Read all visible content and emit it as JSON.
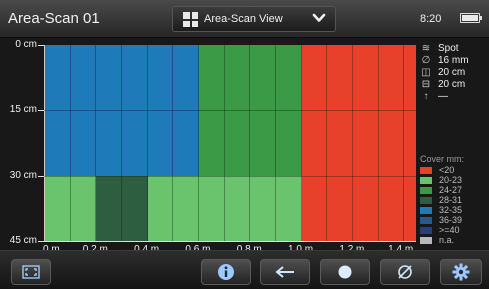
{
  "header": {
    "title": "Area-Scan 01",
    "view_selector": {
      "selected": "Area-Scan View",
      "icon": "grid-icon"
    },
    "time": "8:20",
    "battery_level": 1.0
  },
  "chart_data": {
    "type": "heatmap",
    "x_ticks": [
      "0 m",
      "0.2 m",
      "0.4 m",
      "0.6 m",
      "0.8 m",
      "1.0 m",
      "1.2 m",
      "1.4 m"
    ],
    "y_ticks": [
      "0 cm",
      "15 cm",
      "30 cm",
      "45 cm"
    ],
    "x_range": [
      0,
      1.4
    ],
    "y_range": [
      0,
      45
    ],
    "columns": [
      0,
      0.2,
      0.4,
      0.6,
      0.8,
      1.0,
      1.2,
      1.4
    ],
    "grid_lines": true,
    "cells": [
      {
        "x0": 0.0,
        "x1": 0.6,
        "y0": 0,
        "y1": 30,
        "cover_class": "32-35"
      },
      {
        "x0": 0.6,
        "x1": 1.0,
        "y0": 0,
        "y1": 30,
        "cover_class": "24-27"
      },
      {
        "x0": 1.0,
        "x1": 1.4,
        "y0": 0,
        "y1": 30,
        "cover_class": "<20"
      },
      {
        "x0": 1.4,
        "x1": 1.45,
        "y0": 0,
        "y1": 30,
        "cover_class": "<20"
      },
      {
        "x0": 0.0,
        "x1": 0.2,
        "y0": 30,
        "y1": 45,
        "cover_class": "20-23"
      },
      {
        "x0": 0.2,
        "x1": 0.4,
        "y0": 30,
        "y1": 45,
        "cover_class": "28-31"
      },
      {
        "x0": 0.4,
        "x1": 1.0,
        "y0": 30,
        "y1": 45,
        "cover_class": "20-23"
      },
      {
        "x0": 1.0,
        "x1": 1.45,
        "y0": 30,
        "y1": 45,
        "cover_class": "<20"
      }
    ]
  },
  "settings": [
    {
      "icon": "spot-icon",
      "value": "Spot"
    },
    {
      "icon": "diameter-icon",
      "value": "16 mm"
    },
    {
      "icon": "grid-x-icon",
      "value": "20 cm"
    },
    {
      "icon": "grid-y-icon",
      "value": "20 cm"
    },
    {
      "icon": "arrow-up-icon",
      "value": "—"
    }
  ],
  "legend": {
    "title": "Cover mm:",
    "items": [
      {
        "label": "<20",
        "color": "#e8412b"
      },
      {
        "label": "20-23",
        "color": "#69c46d"
      },
      {
        "label": "24-27",
        "color": "#3a9a45"
      },
      {
        "label": "28-31",
        "color": "#2c5e3f"
      },
      {
        "label": "32-35",
        "color": "#1e7ab8"
      },
      {
        "label": "36-39",
        "color": "#255a8e"
      },
      {
        "label": ">=40",
        "color": "#2a3f7a"
      },
      {
        "label": "n.a.",
        "color": "#b8b8b8"
      }
    ]
  },
  "toolbar": [
    {
      "name": "fullscreen-button",
      "icon": "fullscreen-icon"
    },
    {
      "name": "info-button",
      "icon": "info-icon"
    },
    {
      "name": "back-button",
      "icon": "arrow-left-icon"
    },
    {
      "name": "record-button",
      "icon": "record-icon"
    },
    {
      "name": "diameter-button",
      "icon": "diameter-icon"
    },
    {
      "name": "settings-button",
      "icon": "gear-icon"
    }
  ]
}
